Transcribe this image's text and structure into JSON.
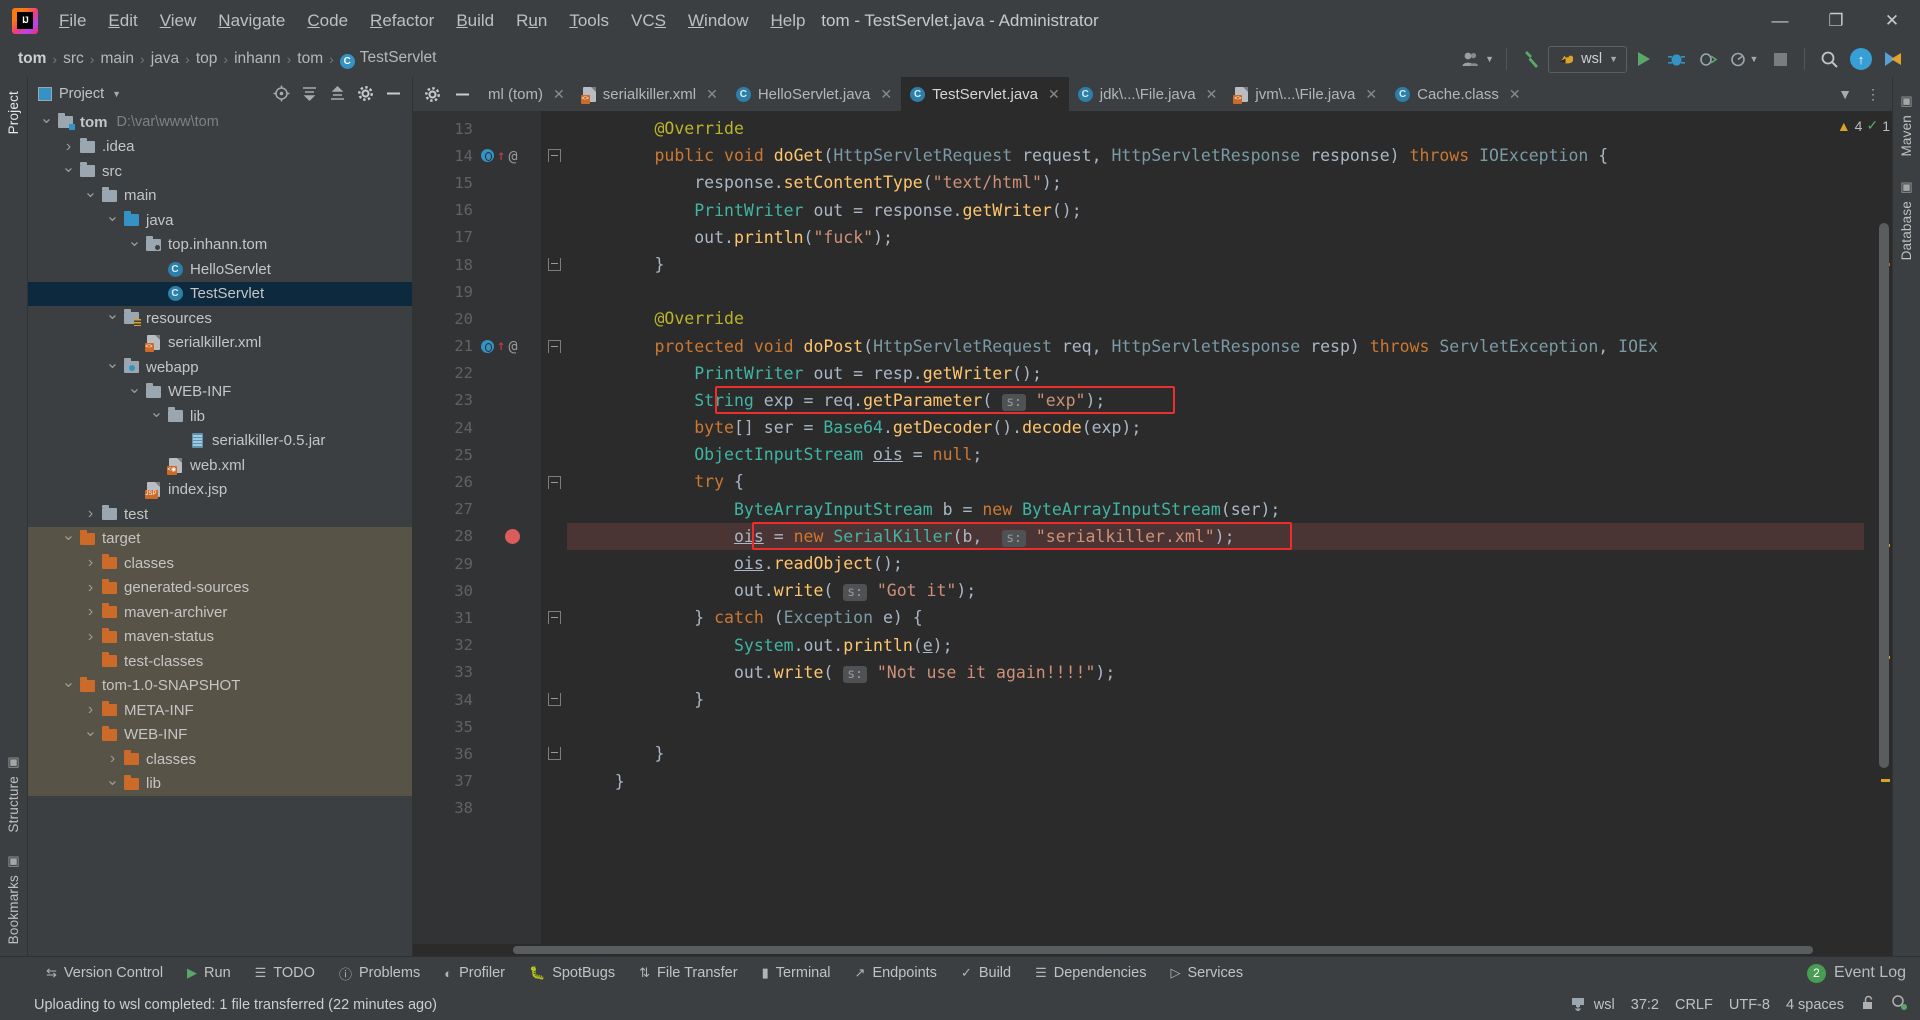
{
  "window": {
    "title": "tom - TestServlet.java - Administrator",
    "controls": {
      "minimize": "—",
      "maximize": "❐",
      "close": "✕"
    }
  },
  "menu": [
    {
      "label": "File",
      "mnemonic": "F"
    },
    {
      "label": "Edit",
      "mnemonic": "E"
    },
    {
      "label": "View",
      "mnemonic": "V"
    },
    {
      "label": "Navigate",
      "mnemonic": "N"
    },
    {
      "label": "Code",
      "mnemonic": "C"
    },
    {
      "label": "Refactor",
      "mnemonic": "R"
    },
    {
      "label": "Build",
      "mnemonic": "B"
    },
    {
      "label": "Run",
      "mnemonic": "u"
    },
    {
      "label": "Tools",
      "mnemonic": "T"
    },
    {
      "label": "VCS",
      "mnemonic": "S"
    },
    {
      "label": "Window",
      "mnemonic": "W"
    },
    {
      "label": "Help",
      "mnemonic": "H"
    }
  ],
  "breadcrumbs": [
    {
      "label": "tom",
      "bold": true
    },
    {
      "label": "src",
      "bold": false
    },
    {
      "label": "main",
      "bold": false
    },
    {
      "label": "java",
      "bold": false
    },
    {
      "label": "top",
      "bold": false
    },
    {
      "label": "inhann",
      "bold": false
    },
    {
      "label": "tom",
      "bold": false
    },
    {
      "label": "TestServlet",
      "bold": false,
      "icon": "class-icon"
    }
  ],
  "toolbar": {
    "account_icon": "user-icon",
    "build_icon": "hammer-icon",
    "run_config": "wsl",
    "run_icon": "run-icon",
    "debug_icon": "debug-icon",
    "coverage_icon": "coverage-icon",
    "profile_icon": "profile-icon",
    "stop_icon": "stop-icon",
    "search_icon": "search-icon",
    "update_icon": "update-icon",
    "browser_icon": "browser-icon"
  },
  "project_pane": {
    "title": "Project",
    "actions": [
      "locate-icon",
      "expand-all-icon",
      "collapse-all-icon",
      "settings-icon",
      "hide-icon"
    ],
    "tree": [
      {
        "depth": 0,
        "twisty": "down",
        "icon": "folder-module",
        "label": "tom",
        "bold": true,
        "path": "D:\\var\\www\\tom"
      },
      {
        "depth": 1,
        "twisty": "right",
        "icon": "folder",
        "label": ".idea"
      },
      {
        "depth": 1,
        "twisty": "down",
        "icon": "folder",
        "label": "src"
      },
      {
        "depth": 2,
        "twisty": "down",
        "icon": "folder",
        "label": "main"
      },
      {
        "depth": 3,
        "twisty": "down",
        "icon": "folder-source",
        "label": "java"
      },
      {
        "depth": 4,
        "twisty": "down",
        "icon": "folder-package",
        "label": "top.inhann.tom"
      },
      {
        "depth": 5,
        "twisty": "none",
        "icon": "class",
        "label": "HelloServlet"
      },
      {
        "depth": 5,
        "twisty": "none",
        "icon": "class",
        "label": "TestServlet",
        "selected": true
      },
      {
        "depth": 3,
        "twisty": "down",
        "icon": "folder-resource",
        "label": "resources"
      },
      {
        "depth": 4,
        "twisty": "none",
        "icon": "file-xml",
        "label": "serialkiller.xml"
      },
      {
        "depth": 3,
        "twisty": "down",
        "icon": "folder-webapp",
        "label": "webapp"
      },
      {
        "depth": 4,
        "twisty": "down",
        "icon": "folder",
        "label": "WEB-INF"
      },
      {
        "depth": 5,
        "twisty": "down",
        "icon": "folder",
        "label": "lib"
      },
      {
        "depth": 6,
        "twisty": "none",
        "icon": "jar",
        "label": "serialkiller-0.5.jar"
      },
      {
        "depth": 5,
        "twisty": "none",
        "icon": "file-webxml",
        "label": "web.xml"
      },
      {
        "depth": 4,
        "twisty": "none",
        "icon": "file-jsp",
        "label": "index.jsp"
      },
      {
        "depth": 2,
        "twisty": "right",
        "icon": "folder",
        "label": "test"
      },
      {
        "depth": 1,
        "twisty": "down",
        "icon": "folder-excluded",
        "label": "target",
        "excluded": true
      },
      {
        "depth": 2,
        "twisty": "right",
        "icon": "folder-excluded",
        "label": "classes",
        "excluded": true
      },
      {
        "depth": 2,
        "twisty": "right",
        "icon": "folder-excluded",
        "label": "generated-sources",
        "excluded": true
      },
      {
        "depth": 2,
        "twisty": "right",
        "icon": "folder-excluded",
        "label": "maven-archiver",
        "excluded": true
      },
      {
        "depth": 2,
        "twisty": "right",
        "icon": "folder-excluded",
        "label": "maven-status",
        "excluded": true
      },
      {
        "depth": 2,
        "twisty": "none",
        "icon": "folder-excluded",
        "label": "test-classes",
        "excluded": true
      },
      {
        "depth": 1,
        "twisty": "down",
        "icon": "folder-excluded",
        "label": "tom-1.0-SNAPSHOT",
        "excluded": true
      },
      {
        "depth": 2,
        "twisty": "right",
        "icon": "folder-excluded",
        "label": "META-INF",
        "excluded": true
      },
      {
        "depth": 2,
        "twisty": "down",
        "icon": "folder-excluded",
        "label": "WEB-INF",
        "excluded": true
      },
      {
        "depth": 3,
        "twisty": "right",
        "icon": "folder-excluded",
        "label": "classes",
        "excluded": true
      },
      {
        "depth": 3,
        "twisty": "down",
        "icon": "folder-excluded",
        "label": "lib",
        "excluded": true
      }
    ]
  },
  "left_strip": {
    "top_label": "Project",
    "bottom_labels": [
      "Structure",
      "Bookmarks"
    ]
  },
  "right_strip": {
    "labels": [
      "Maven",
      "Database"
    ]
  },
  "tabs": [
    {
      "label": "ml (tom)",
      "icon": "maven-icon",
      "active": false,
      "truncated": true
    },
    {
      "label": "serialkiller.xml",
      "icon": "xml-icon",
      "active": false
    },
    {
      "label": "HelloServlet.java",
      "icon": "class-icon",
      "active": false
    },
    {
      "label": "TestServlet.java",
      "icon": "class-icon",
      "active": true
    },
    {
      "label": "jdk\\...\\File.java",
      "icon": "class-icon",
      "active": false
    },
    {
      "label": "jvm\\...\\File.java",
      "icon": "xml-icon",
      "active": false
    },
    {
      "label": "Cache.class",
      "icon": "class-icon",
      "active": false
    }
  ],
  "inspections": {
    "warnings": "4",
    "checks": "1",
    "warning_icon": "warning-triangle-icon",
    "ok_icon": "check-icon"
  },
  "code": {
    "first_line_number": 13,
    "lines": [
      {
        "n": 13,
        "html": "        <span class='an'>@Override</span>"
      },
      {
        "n": 14,
        "html": "        <span class='kw'>public</span> <span class='kw'>void</span> <span class='fn'>doGet</span><span class='pl'>(</span><span class='ty2'>HttpServletRequest</span> <span class='pl'>request,</span> <span class='ty2'>HttpServletResponse</span> <span class='pl'>response)</span> <span class='kw'>throws</span> <span class='ty2'>IOException</span> <span class='pl'>{</span>",
        "gutter": "override-run"
      },
      {
        "n": 15,
        "html": "            <span class='pl'>response.</span><span class='fn'>setContentType</span><span class='pl'>(</span><span class='st'>\"text/html\"</span><span class='pl'>);</span>"
      },
      {
        "n": 16,
        "html": "            <span class='ty'>PrintWriter</span> <span class='pl'>out = response.</span><span class='fn'>getWriter</span><span class='pl'>();</span>"
      },
      {
        "n": 17,
        "html": "            <span class='pl'>out.</span><span class='fn'>println</span><span class='pl'>(</span><span class='st'>\"fuck\"</span><span class='pl'>);</span>"
      },
      {
        "n": 18,
        "html": "        <span class='pl'>}</span>",
        "fold": "up"
      },
      {
        "n": 19,
        "html": ""
      },
      {
        "n": 20,
        "html": "        <span class='an'>@Override</span>"
      },
      {
        "n": 21,
        "html": "        <span class='kw'>protected</span> <span class='kw'>void</span> <span class='fn'>doPost</span><span class='pl'>(</span><span class='ty2'>HttpServletRequest</span> <span class='pl'>req,</span> <span class='ty2'>HttpServletResponse</span> <span class='pl'>resp)</span> <span class='kw'>throws</span> <span class='ty2'>ServletException</span><span class='pl'>,</span> <span class='ty2'>IOEx</span>",
        "gutter": "override-run"
      },
      {
        "n": 22,
        "html": "            <span class='ty'>PrintWriter</span> <span class='pl'>out = resp.</span><span class='fn'>getWriter</span><span class='pl'>();</span>"
      },
      {
        "n": 23,
        "html": "            <span class='ty'>String</span> <span class='pl'>exp = req.</span><span class='fn'>getParameter</span><span class='pl'>(</span> <span class='hint'>s:</span> <span class='st'>\"exp\"</span><span class='pl'>);</span>",
        "boxed": 1
      },
      {
        "n": 24,
        "html": "            <span class='kw'>byte</span><span class='pl'>[] ser = </span><span class='ty'>Base64</span><span class='pl'>.</span><span class='fn'>getDecoder</span><span class='pl'>().</span><span class='fn'>decode</span><span class='pl'>(exp);</span>"
      },
      {
        "n": 25,
        "html": "            <span class='ty'>ObjectInputStream</span> <span class='pl ul'>ois</span> <span class='pl'>= </span><span class='kw'>null</span><span class='pl'>;</span>"
      },
      {
        "n": 26,
        "html": "            <span class='kw'>try</span> <span class='pl'>{</span>",
        "fold": "down"
      },
      {
        "n": 27,
        "html": "                <span class='ty'>ByteArrayInputStream</span> <span class='pl'>b = </span><span class='kw'>new</span> <span class='ty'>ByteArrayInputStream</span><span class='pl'>(ser);</span>"
      },
      {
        "n": 28,
        "html": "                <span class='pl ul'>ois</span> <span class='pl'>= </span><span class='kw'>new</span> <span class='ty'>SerialKiller</span><span class='pl'>(b,</span>  <span class='hint'>s:</span> <span class='st'>\"serialkiller.xml\"</span><span class='pl'>);</span>",
        "breakpoint": true,
        "boxed": 2
      },
      {
        "n": 29,
        "html": "                <span class='pl ul'>ois</span><span class='pl'>.</span><span class='fn'>readObject</span><span class='pl'>();</span>"
      },
      {
        "n": 30,
        "html": "                <span class='pl'>out.</span><span class='fn'>write</span><span class='pl'>(</span> <span class='hint'>s:</span> <span class='st'>\"Got it\"</span><span class='pl'>);</span>"
      },
      {
        "n": 31,
        "html": "            <span class='pl'>} </span><span class='kw'>catch</span> <span class='pl'>(</span><span class='ty2'>Exception</span> <span class='pl'>e) {</span>",
        "fold": "mid"
      },
      {
        "n": 32,
        "html": "                <span class='ty'>System</span><span class='pl'>.out.</span><span class='fn'>println</span><span class='pl'>(</span><span class='pl ul'>e</span><span class='pl'>);</span>"
      },
      {
        "n": 33,
        "html": "                <span class='pl'>out.</span><span class='fn'>write</span><span class='pl'>(</span> <span class='hint'>s:</span> <span class='st'>\"Not use it again!!!!\"</span><span class='pl'>);</span>"
      },
      {
        "n": 34,
        "html": "            <span class='pl'>}</span>",
        "fold": "up"
      },
      {
        "n": 35,
        "html": ""
      },
      {
        "n": 36,
        "html": "        <span class='pl'>}</span>",
        "fold": "up"
      },
      {
        "n": 37,
        "html": "    <span class='pl'>}</span>"
      },
      {
        "n": 38,
        "html": ""
      }
    ]
  },
  "bottom_windows": [
    {
      "label": "Version Control",
      "icon": "vcs-icon"
    },
    {
      "label": "Run",
      "icon": "run-icon"
    },
    {
      "label": "TODO",
      "icon": "todo-icon"
    },
    {
      "label": "Problems",
      "icon": "problems-icon"
    },
    {
      "label": "Profiler",
      "icon": "profiler-icon"
    },
    {
      "label": "SpotBugs",
      "icon": "bug-icon"
    },
    {
      "label": "File Transfer",
      "icon": "transfer-icon"
    },
    {
      "label": "Terminal",
      "icon": "terminal-icon"
    },
    {
      "label": "Endpoints",
      "icon": "endpoints-icon"
    },
    {
      "label": "Build",
      "icon": "build-icon"
    },
    {
      "label": "Dependencies",
      "icon": "dependencies-icon"
    },
    {
      "label": "Services",
      "icon": "services-icon"
    }
  ],
  "event_log": {
    "label": "Event Log",
    "count": "2"
  },
  "statusbar": {
    "message": "Uploading to wsl completed: 1 file transferred (22 minutes ago)",
    "deployment": "wsl",
    "caret": "37:2",
    "line_separator": "CRLF",
    "encoding": "UTF-8",
    "indent": "4 spaces",
    "lock_icon": "unlocked-icon",
    "inspect_icon": "inspection-icon"
  },
  "colors": {
    "ide_bg": "#3c3f41",
    "editor_bg": "#2b2b2b",
    "gutter_bg": "#313335",
    "selection": "#0d293e",
    "excluded": "#585347",
    "accent_blue": "#3592c4",
    "accent_orange": "#cc6a29",
    "green": "#59a869",
    "red_box": "#ef2d2d",
    "breakpoint": "#db5c5c"
  }
}
